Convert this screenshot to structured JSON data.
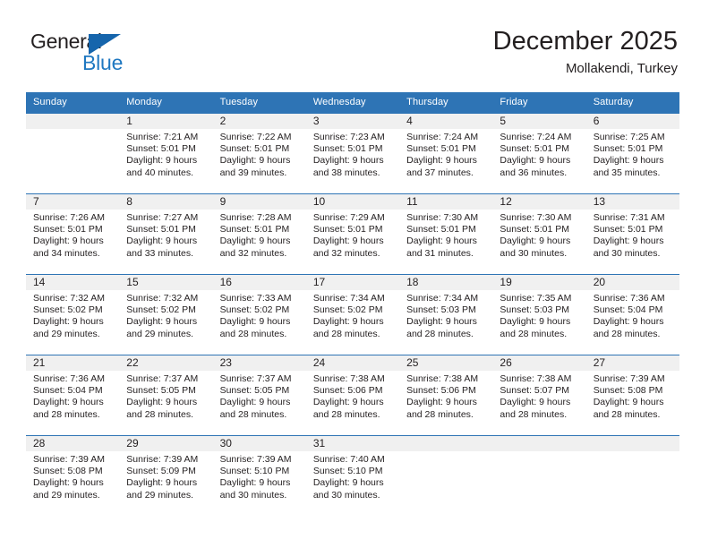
{
  "brand": {
    "name_top": "General",
    "name_bottom": "Blue",
    "flag_color": "#1665ac",
    "blue_color": "#1f78c1"
  },
  "header": {
    "title": "December 2025",
    "subtitle": "Mollakendi, Turkey"
  },
  "calendar": {
    "header_color": "#2e74b5",
    "daynum_band_color": "#f0f0f0",
    "weekday_headers": [
      "Sunday",
      "Monday",
      "Tuesday",
      "Wednesday",
      "Thursday",
      "Friday",
      "Saturday"
    ],
    "weeks": [
      [
        {
          "day": "",
          "sunrise": "",
          "sunset": "",
          "daylight_line1": "",
          "daylight_line2": "",
          "empty": true
        },
        {
          "day": "1",
          "sunrise": "Sunrise: 7:21 AM",
          "sunset": "Sunset: 5:01 PM",
          "daylight_line1": "Daylight: 9 hours",
          "daylight_line2": "and 40 minutes."
        },
        {
          "day": "2",
          "sunrise": "Sunrise: 7:22 AM",
          "sunset": "Sunset: 5:01 PM",
          "daylight_line1": "Daylight: 9 hours",
          "daylight_line2": "and 39 minutes."
        },
        {
          "day": "3",
          "sunrise": "Sunrise: 7:23 AM",
          "sunset": "Sunset: 5:01 PM",
          "daylight_line1": "Daylight: 9 hours",
          "daylight_line2": "and 38 minutes."
        },
        {
          "day": "4",
          "sunrise": "Sunrise: 7:24 AM",
          "sunset": "Sunset: 5:01 PM",
          "daylight_line1": "Daylight: 9 hours",
          "daylight_line2": "and 37 minutes."
        },
        {
          "day": "5",
          "sunrise": "Sunrise: 7:24 AM",
          "sunset": "Sunset: 5:01 PM",
          "daylight_line1": "Daylight: 9 hours",
          "daylight_line2": "and 36 minutes."
        },
        {
          "day": "6",
          "sunrise": "Sunrise: 7:25 AM",
          "sunset": "Sunset: 5:01 PM",
          "daylight_line1": "Daylight: 9 hours",
          "daylight_line2": "and 35 minutes."
        }
      ],
      [
        {
          "day": "7",
          "sunrise": "Sunrise: 7:26 AM",
          "sunset": "Sunset: 5:01 PM",
          "daylight_line1": "Daylight: 9 hours",
          "daylight_line2": "and 34 minutes."
        },
        {
          "day": "8",
          "sunrise": "Sunrise: 7:27 AM",
          "sunset": "Sunset: 5:01 PM",
          "daylight_line1": "Daylight: 9 hours",
          "daylight_line2": "and 33 minutes."
        },
        {
          "day": "9",
          "sunrise": "Sunrise: 7:28 AM",
          "sunset": "Sunset: 5:01 PM",
          "daylight_line1": "Daylight: 9 hours",
          "daylight_line2": "and 32 minutes."
        },
        {
          "day": "10",
          "sunrise": "Sunrise: 7:29 AM",
          "sunset": "Sunset: 5:01 PM",
          "daylight_line1": "Daylight: 9 hours",
          "daylight_line2": "and 32 minutes."
        },
        {
          "day": "11",
          "sunrise": "Sunrise: 7:30 AM",
          "sunset": "Sunset: 5:01 PM",
          "daylight_line1": "Daylight: 9 hours",
          "daylight_line2": "and 31 minutes."
        },
        {
          "day": "12",
          "sunrise": "Sunrise: 7:30 AM",
          "sunset": "Sunset: 5:01 PM",
          "daylight_line1": "Daylight: 9 hours",
          "daylight_line2": "and 30 minutes."
        },
        {
          "day": "13",
          "sunrise": "Sunrise: 7:31 AM",
          "sunset": "Sunset: 5:01 PM",
          "daylight_line1": "Daylight: 9 hours",
          "daylight_line2": "and 30 minutes."
        }
      ],
      [
        {
          "day": "14",
          "sunrise": "Sunrise: 7:32 AM",
          "sunset": "Sunset: 5:02 PM",
          "daylight_line1": "Daylight: 9 hours",
          "daylight_line2": "and 29 minutes."
        },
        {
          "day": "15",
          "sunrise": "Sunrise: 7:32 AM",
          "sunset": "Sunset: 5:02 PM",
          "daylight_line1": "Daylight: 9 hours",
          "daylight_line2": "and 29 minutes."
        },
        {
          "day": "16",
          "sunrise": "Sunrise: 7:33 AM",
          "sunset": "Sunset: 5:02 PM",
          "daylight_line1": "Daylight: 9 hours",
          "daylight_line2": "and 28 minutes."
        },
        {
          "day": "17",
          "sunrise": "Sunrise: 7:34 AM",
          "sunset": "Sunset: 5:02 PM",
          "daylight_line1": "Daylight: 9 hours",
          "daylight_line2": "and 28 minutes."
        },
        {
          "day": "18",
          "sunrise": "Sunrise: 7:34 AM",
          "sunset": "Sunset: 5:03 PM",
          "daylight_line1": "Daylight: 9 hours",
          "daylight_line2": "and 28 minutes."
        },
        {
          "day": "19",
          "sunrise": "Sunrise: 7:35 AM",
          "sunset": "Sunset: 5:03 PM",
          "daylight_line1": "Daylight: 9 hours",
          "daylight_line2": "and 28 minutes."
        },
        {
          "day": "20",
          "sunrise": "Sunrise: 7:36 AM",
          "sunset": "Sunset: 5:04 PM",
          "daylight_line1": "Daylight: 9 hours",
          "daylight_line2": "and 28 minutes."
        }
      ],
      [
        {
          "day": "21",
          "sunrise": "Sunrise: 7:36 AM",
          "sunset": "Sunset: 5:04 PM",
          "daylight_line1": "Daylight: 9 hours",
          "daylight_line2": "and 28 minutes."
        },
        {
          "day": "22",
          "sunrise": "Sunrise: 7:37 AM",
          "sunset": "Sunset: 5:05 PM",
          "daylight_line1": "Daylight: 9 hours",
          "daylight_line2": "and 28 minutes."
        },
        {
          "day": "23",
          "sunrise": "Sunrise: 7:37 AM",
          "sunset": "Sunset: 5:05 PM",
          "daylight_line1": "Daylight: 9 hours",
          "daylight_line2": "and 28 minutes."
        },
        {
          "day": "24",
          "sunrise": "Sunrise: 7:38 AM",
          "sunset": "Sunset: 5:06 PM",
          "daylight_line1": "Daylight: 9 hours",
          "daylight_line2": "and 28 minutes."
        },
        {
          "day": "25",
          "sunrise": "Sunrise: 7:38 AM",
          "sunset": "Sunset: 5:06 PM",
          "daylight_line1": "Daylight: 9 hours",
          "daylight_line2": "and 28 minutes."
        },
        {
          "day": "26",
          "sunrise": "Sunrise: 7:38 AM",
          "sunset": "Sunset: 5:07 PM",
          "daylight_line1": "Daylight: 9 hours",
          "daylight_line2": "and 28 minutes."
        },
        {
          "day": "27",
          "sunrise": "Sunrise: 7:39 AM",
          "sunset": "Sunset: 5:08 PM",
          "daylight_line1": "Daylight: 9 hours",
          "daylight_line2": "and 28 minutes."
        }
      ],
      [
        {
          "day": "28",
          "sunrise": "Sunrise: 7:39 AM",
          "sunset": "Sunset: 5:08 PM",
          "daylight_line1": "Daylight: 9 hours",
          "daylight_line2": "and 29 minutes."
        },
        {
          "day": "29",
          "sunrise": "Sunrise: 7:39 AM",
          "sunset": "Sunset: 5:09 PM",
          "daylight_line1": "Daylight: 9 hours",
          "daylight_line2": "and 29 minutes."
        },
        {
          "day": "30",
          "sunrise": "Sunrise: 7:39 AM",
          "sunset": "Sunset: 5:10 PM",
          "daylight_line1": "Daylight: 9 hours",
          "daylight_line2": "and 30 minutes."
        },
        {
          "day": "31",
          "sunrise": "Sunrise: 7:40 AM",
          "sunset": "Sunset: 5:10 PM",
          "daylight_line1": "Daylight: 9 hours",
          "daylight_line2": "and 30 minutes."
        },
        {
          "day": "",
          "sunrise": "",
          "sunset": "",
          "daylight_line1": "",
          "daylight_line2": "",
          "empty": true
        },
        {
          "day": "",
          "sunrise": "",
          "sunset": "",
          "daylight_line1": "",
          "daylight_line2": "",
          "empty": true
        },
        {
          "day": "",
          "sunrise": "",
          "sunset": "",
          "daylight_line1": "",
          "daylight_line2": "",
          "empty": true
        }
      ]
    ]
  }
}
